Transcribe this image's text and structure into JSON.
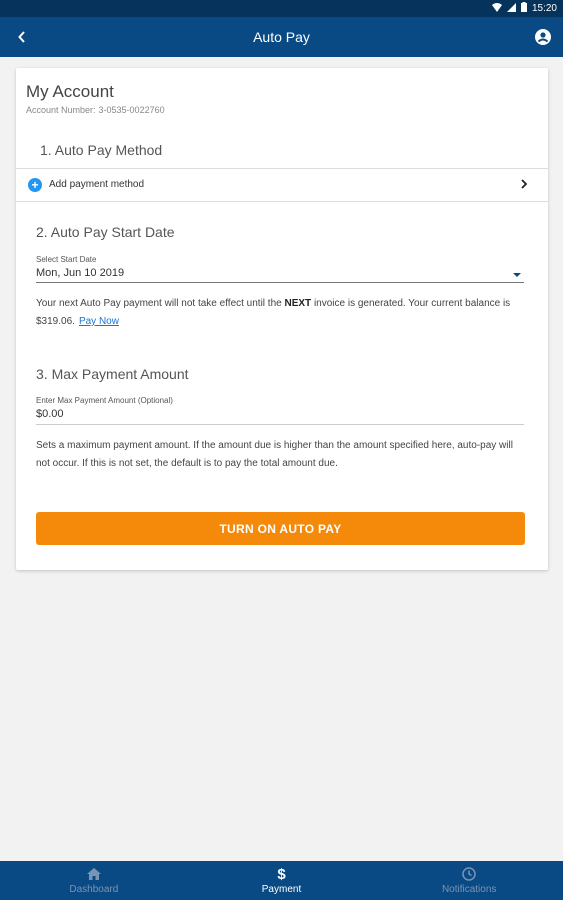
{
  "status_bar": {
    "time": "15:20"
  },
  "app_bar": {
    "title": "Auto Pay"
  },
  "account": {
    "title": "My Account",
    "number_label": "Account Number:",
    "number": "3-0535-0022760"
  },
  "section1": {
    "heading": "1. Auto Pay Method",
    "add_payment_label": "Add payment method"
  },
  "section2": {
    "heading": "2. Auto Pay Start Date",
    "field_label": "Select Start Date",
    "field_value": "Mon, Jun 10 2019",
    "note_part1": "Your next Auto Pay payment will not take effect until the ",
    "note_bold": "NEXT",
    "note_part2": " invoice is generated. Your current balance is $319.06.",
    "pay_now_link": "Pay Now"
  },
  "section3": {
    "heading": "3. Max Payment Amount",
    "field_label": "Enter Max Payment Amount (Optional)",
    "field_value": "$0.00",
    "note": "Sets a maximum payment amount. If the amount due is higher than the amount specified here, auto-pay will not occur. If this is not set, the default is to pay the total amount due."
  },
  "cta_label": "TURN ON AUTO PAY",
  "bottom_nav": [
    {
      "label": "Dashboard",
      "icon": "home-icon"
    },
    {
      "label": "Payment",
      "icon": "dollar-icon"
    },
    {
      "label": "Notifications",
      "icon": "clock-icon"
    }
  ],
  "colors": {
    "primary": "#0a4a84",
    "accent": "#f5890a",
    "link": "#1976d2",
    "add_icon": "#2196f3"
  }
}
